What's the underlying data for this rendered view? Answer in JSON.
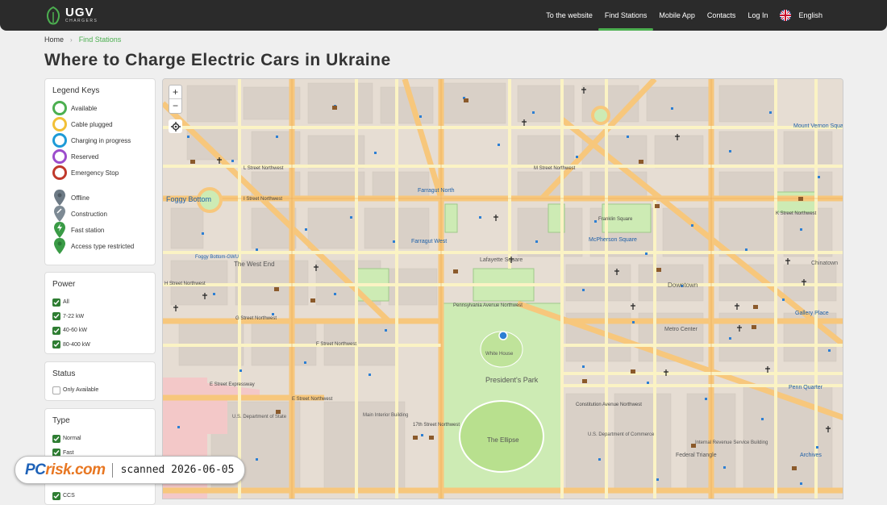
{
  "header": {
    "logo_main": "UGV",
    "logo_sub": "CHARGERS",
    "nav": [
      {
        "label": "To the website"
      },
      {
        "label": "Find Stations",
        "active": true
      },
      {
        "label": "Mobile App"
      },
      {
        "label": "Contacts"
      },
      {
        "label": "Log In"
      }
    ],
    "language": "English",
    "flag_icon": "uk-flag-icon"
  },
  "breadcrumb": {
    "home": "Home",
    "current": "Find Stations"
  },
  "page_title": "Where to Charge Electric Cars in Ukraine",
  "legend": {
    "title": "Legend Keys",
    "status_items": [
      {
        "label": "Available",
        "color": "#4caf50"
      },
      {
        "label": "Cable plugged",
        "color": "#f2c037"
      },
      {
        "label": "Charging in progress",
        "color": "#1e9bd7"
      },
      {
        "label": "Reserved",
        "color": "#9c4dcc"
      },
      {
        "label": "Emergency Stop",
        "color": "#c0392b"
      }
    ],
    "marker_items": [
      {
        "label": "Offline",
        "color": "#6d7a85"
      },
      {
        "label": "Construction",
        "color": "#7d8a94"
      },
      {
        "label": "Fast station",
        "color": "#3a9b46"
      },
      {
        "label": "Access type restricted",
        "color": "#3a9b46"
      }
    ]
  },
  "power": {
    "title": "Power",
    "options": [
      {
        "label": "All",
        "checked": true
      },
      {
        "label": "7-22 kW",
        "checked": true
      },
      {
        "label": "40-60 kW",
        "checked": true
      },
      {
        "label": "80-400 kW",
        "checked": true
      }
    ]
  },
  "status": {
    "title": "Status",
    "options": [
      {
        "label": "Only Available",
        "checked": false
      }
    ]
  },
  "type": {
    "title": "Type",
    "options": [
      {
        "label": "Normal",
        "checked": true
      },
      {
        "label": "Fast",
        "checked": true
      },
      {
        "label": "CCS",
        "checked": true
      }
    ]
  },
  "map": {
    "zoom_in": "+",
    "zoom_out": "−",
    "locate_icon": "crosshair-icon",
    "labels": [
      "Foggy Bottom",
      "Farragut North",
      "Farragut West",
      "McPherson Square",
      "Lafayette Square",
      "President's Park",
      "The Ellipse",
      "White House",
      "Downtown",
      "Metro Center",
      "Gallery Place",
      "Penn Quarter",
      "Chinatown",
      "Mount Vernon Square",
      "The West End",
      "Foggy Bottom-GWU",
      "Federal Triangle",
      "Archives",
      "Main Interior Building",
      "U.S. Department of State",
      "U.S. Department of Commerce",
      "Internal Revenue Service Building",
      "Franklin Square",
      "K Street Northwest",
      "L Street Northwest",
      "M Street Northwest",
      "I Street Northwest",
      "H Street Northwest",
      "G Street Northwest",
      "F Street Northwest",
      "E Street Northwest",
      "E Street Expressway",
      "Pennsylvania Avenue Northwest",
      "Constitution Avenue Northwest",
      "17th Street Northwest"
    ]
  },
  "watermark": {
    "brand_pc": "PC",
    "brand_risk": "risk.com",
    "text": "scanned 2026-06-05"
  }
}
